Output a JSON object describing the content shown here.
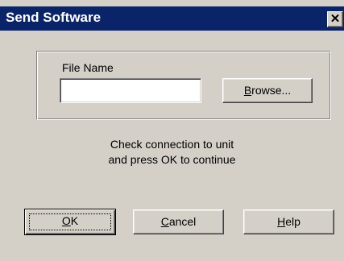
{
  "window": {
    "title": "Send Software",
    "close_glyph": "✕"
  },
  "file_group": {
    "label": "File Name",
    "value": "",
    "browse": {
      "mnemonic": "B",
      "rest": "rowse..."
    }
  },
  "message": {
    "line1": "Check connection to unit",
    "line2": "and press OK to continue"
  },
  "buttons": {
    "ok": {
      "mnemonic": "O",
      "rest": "K"
    },
    "cancel": {
      "mnemonic": "C",
      "rest": "ancel"
    },
    "help": {
      "mnemonic": "H",
      "rest": "elp"
    }
  },
  "colors": {
    "titlebar": "#0a246a",
    "face": "#d4d0c8",
    "title_text": "#ffffff"
  }
}
